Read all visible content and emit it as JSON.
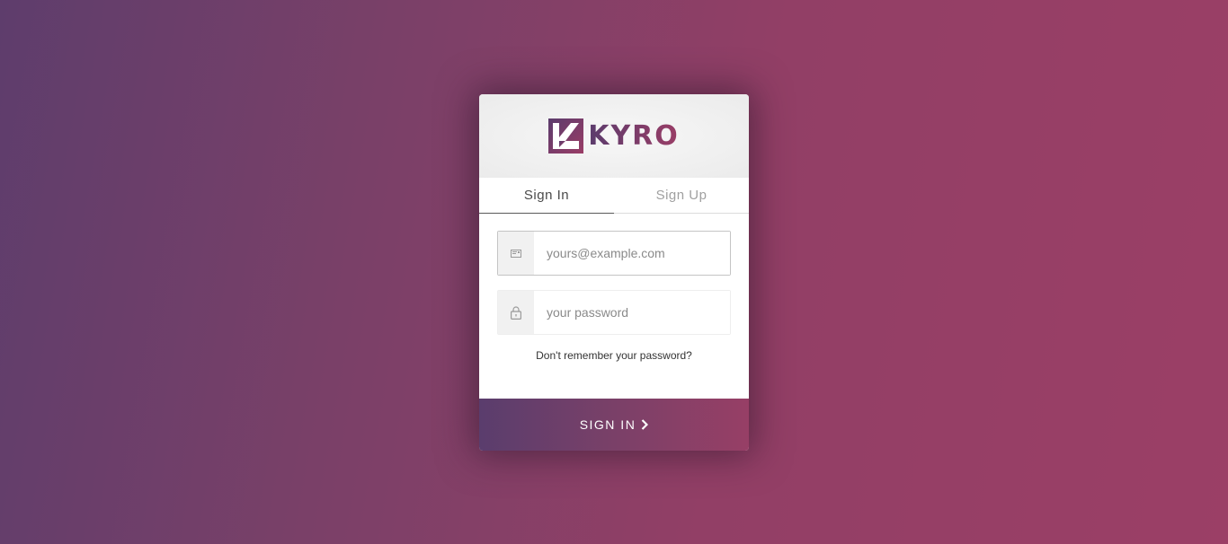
{
  "brand": {
    "name": "KYRO",
    "gradient_start": "#5b3c6d",
    "gradient_end": "#9a3d66"
  },
  "tabs": [
    {
      "label": "Sign In",
      "active": true
    },
    {
      "label": "Sign Up",
      "active": false
    }
  ],
  "form": {
    "email": {
      "placeholder": "yours@example.com",
      "value": "",
      "icon": "envelope-icon"
    },
    "password": {
      "placeholder": "your password",
      "value": "",
      "icon": "lock-icon"
    },
    "forgot_label": "Don't remember your password?"
  },
  "submit": {
    "label": "SIGN IN",
    "icon": "chevron-right-icon"
  }
}
